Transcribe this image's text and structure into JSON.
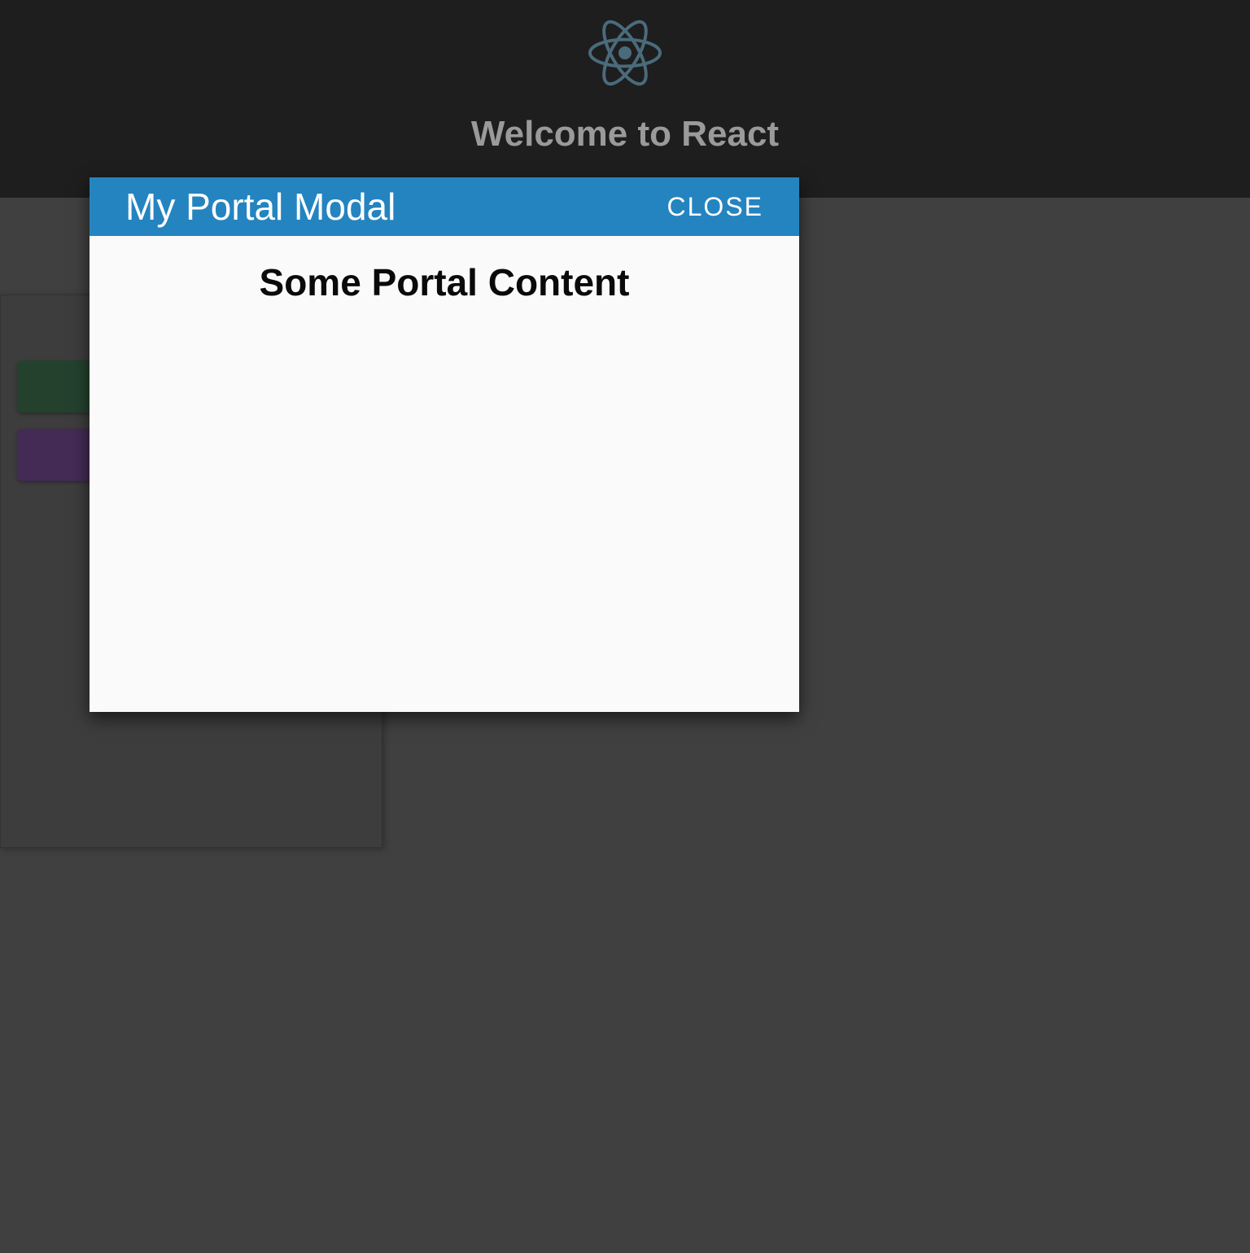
{
  "header": {
    "title": "Welcome to React",
    "logo_name": "react-logo-icon",
    "logo_color": "#4a6b7c"
  },
  "panel": {
    "buttons": [
      {
        "name": "action-button-1",
        "color": "#24412e"
      },
      {
        "name": "action-button-2",
        "color": "#432b55"
      }
    ]
  },
  "modal": {
    "title": "My Portal Modal",
    "close_label": "CLOSE",
    "content_heading": "Some Portal Content",
    "header_bg": "#2484c0",
    "body_bg": "#fafafa"
  }
}
